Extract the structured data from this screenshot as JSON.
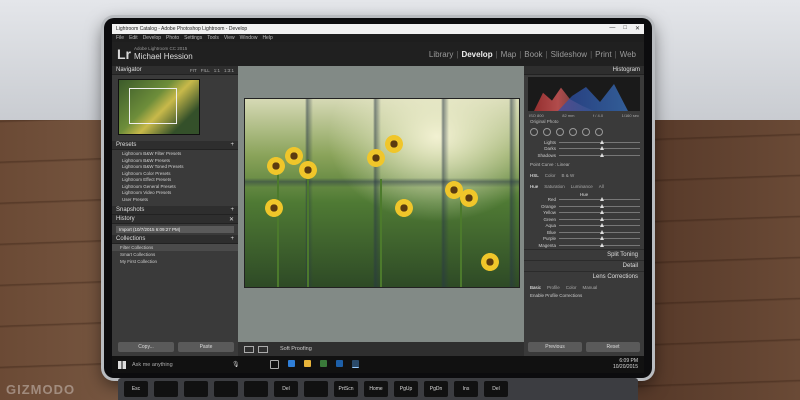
{
  "window": {
    "title": "Lightroom Catalog - Adobe Photoshop Lightroom - Develop",
    "controls": [
      "—",
      "□",
      "✕"
    ]
  },
  "menu": [
    "File",
    "Edit",
    "Develop",
    "Photo",
    "Settings",
    "Tools",
    "View",
    "Window",
    "Help"
  ],
  "identity": {
    "logo": "Lr",
    "version": "Adobe Lightroom CC 2015",
    "user": "Michael Hession"
  },
  "modules": [
    {
      "label": "Library",
      "active": false
    },
    {
      "label": "Develop",
      "active": true
    },
    {
      "label": "Map",
      "active": false
    },
    {
      "label": "Book",
      "active": false
    },
    {
      "label": "Slideshow",
      "active": false
    },
    {
      "label": "Print",
      "active": false
    },
    {
      "label": "Web",
      "active": false
    }
  ],
  "left": {
    "navigator": {
      "title": "Navigator",
      "modes": [
        "FIT",
        "FILL",
        "1:1",
        "1:3:1"
      ]
    },
    "presets": {
      "title": "Presets",
      "items": [
        "Lightroom B&W Filter Presets",
        "Lightroom B&W Presets",
        "Lightroom B&W Toned Presets",
        "Lightroom Color Presets",
        "Lightroom Effect Presets",
        "Lightroom General Presets",
        "Lightroom Video Presets",
        "User Presets"
      ]
    },
    "snapshots": {
      "title": "Snapshots"
    },
    "history": {
      "title": "History",
      "item": "Import (10/7/2015 6:09:27 PM)"
    },
    "collections": {
      "title": "Collections",
      "items": [
        "Filter Collections",
        "Smart Collections",
        "My First Collection"
      ]
    },
    "buttons": {
      "copy": "Copy...",
      "paste": "Paste"
    }
  },
  "toolbar": {
    "soft_proofing": "Soft Proofing"
  },
  "right": {
    "histogram": {
      "title": "Histogram",
      "info": [
        "ISO 800",
        "82 mm",
        "f / 4.0",
        "1/160 sec"
      ]
    },
    "original_photo": "Original Photo",
    "tone_sliders": [
      {
        "label": "Lights"
      },
      {
        "label": "Darks"
      },
      {
        "label": "Shadows"
      }
    ],
    "point_curve": {
      "label": "Point Curve :",
      "value": "Linear"
    },
    "hsl_tabs": [
      "HSL",
      "Color",
      "B & W"
    ],
    "hsl_subtabs": [
      "Hue",
      "Saturation",
      "Luminance",
      "All"
    ],
    "hue_title": "Hue",
    "hue_sliders": [
      "Red",
      "Orange",
      "Yellow",
      "Green",
      "Aqua",
      "Blue",
      "Purple",
      "Magenta"
    ],
    "sections": [
      "Split Toning",
      "Detail",
      "Lens Corrections"
    ],
    "lens_tabs": [
      "Basic",
      "Profile",
      "Color",
      "Manual"
    ],
    "lens_option": "Enable Profile Corrections",
    "buttons": {
      "previous": "Previous",
      "reset": "Reset"
    }
  },
  "taskbar": {
    "search_placeholder": "Ask me anything",
    "time": "6:09 PM",
    "date": "10/20/2015"
  },
  "keyboard": {
    "keys": [
      "Esc",
      "",
      "",
      "",
      "",
      "Del",
      "",
      "PrtScn",
      "Home",
      "PgUp",
      "PgDn",
      "Ins",
      "Del"
    ]
  },
  "watermark": "GIZMODO",
  "colors": {
    "accent": "#eeeeee",
    "panel": "#3a3a3a",
    "flower": "#f0c62a"
  }
}
